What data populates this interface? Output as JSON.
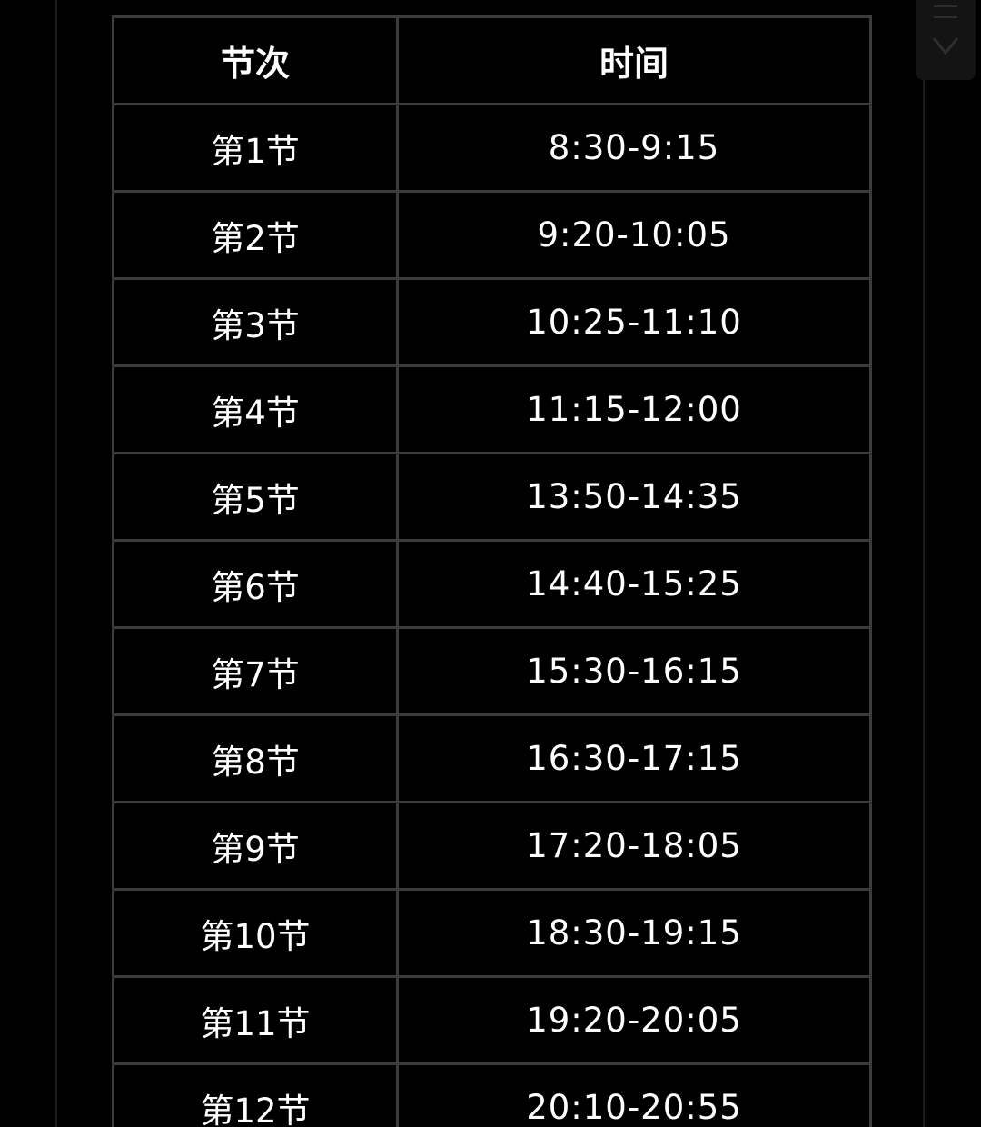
{
  "table": {
    "headers": [
      "节次",
      "时间"
    ],
    "rows": [
      {
        "period": "第1节",
        "time": "8:30-9:15"
      },
      {
        "period": "第2节",
        "time": "9:20-10:05"
      },
      {
        "period": "第3节",
        "time": "10:25-11:10"
      },
      {
        "period": "第4节",
        "time": "11:15-12:00"
      },
      {
        "period": "第5节",
        "time": "13:50-14:35"
      },
      {
        "period": "第6节",
        "time": "14:40-15:25"
      },
      {
        "period": "第7节",
        "time": "15:30-16:15"
      },
      {
        "period": "第8节",
        "time": "16:30-17:15"
      },
      {
        "period": "第9节",
        "time": "17:20-18:05"
      },
      {
        "period": "第10节",
        "time": "18:30-19:15"
      },
      {
        "period": "第11节",
        "time": "19:20-20:05"
      },
      {
        "period": "第12节",
        "time": "20:10-20:55"
      }
    ]
  },
  "icons": {
    "scroll_menu": "menu-bars-icon",
    "scroll_down": "chevron-down-icon"
  },
  "colors": {
    "background": "#000000",
    "grid": "#3c3c3c",
    "text": "#ffffff"
  }
}
